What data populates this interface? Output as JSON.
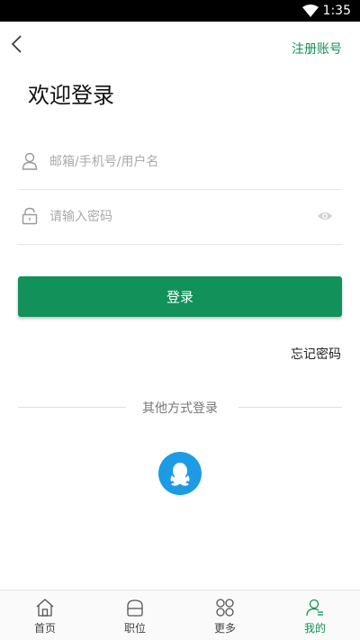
{
  "status_bar": {
    "time": "1:35",
    "icons": [
      "wifi-icon"
    ]
  },
  "header": {
    "back_icon": "chevron-left-icon",
    "register_label": "注册账号"
  },
  "page_title": "欢迎登录",
  "form": {
    "username": {
      "value": "",
      "placeholder": "邮箱/手机号/用户名",
      "icon": "user-icon"
    },
    "password": {
      "value": "",
      "placeholder": "请输入密码",
      "icon": "lock-icon",
      "toggle_icon": "eye-icon"
    },
    "login_label": "登录",
    "forgot_label": "忘记密码"
  },
  "other_login": {
    "label": "其他方式登录",
    "providers": [
      {
        "icon": "qq-icon"
      }
    ]
  },
  "tabbar": {
    "items": [
      {
        "label": "首页",
        "icon": "home-icon"
      },
      {
        "label": "职位",
        "icon": "briefcase-icon"
      },
      {
        "label": "更多",
        "icon": "grid-icon"
      },
      {
        "label": "我的",
        "icon": "profile-icon"
      }
    ],
    "active_index": 3
  },
  "colors": {
    "accent": "#13915a",
    "qq": "#1d9be4",
    "status_bar": "#000000"
  }
}
